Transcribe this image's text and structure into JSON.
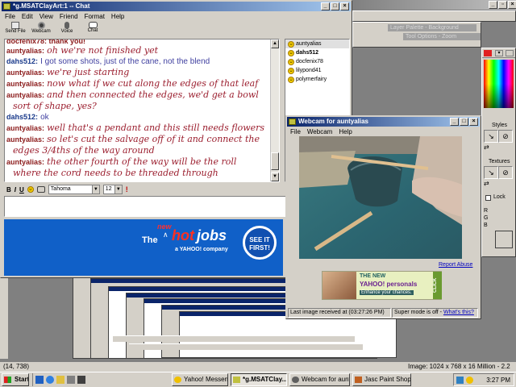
{
  "chat": {
    "title": "*g.MSATClayArt:1 -- Chat",
    "menus": [
      "File",
      "Edit",
      "View",
      "Friend",
      "Format",
      "Help"
    ],
    "toolbar": [
      "Send File",
      "Webcam",
      "Voice",
      "Chat"
    ],
    "partial_top": "docfenix78: thank you!",
    "lines": [
      {
        "who": "auntyalias:",
        "text": "oh we're not finished yet",
        "kind": "a"
      },
      {
        "who": "dahs512:",
        "text": "I got some shots, just of the cane, not the blend",
        "kind": "d"
      },
      {
        "who": "auntyalias:",
        "text": "we're just starting",
        "kind": "a"
      },
      {
        "who": "auntyalias:",
        "text": "now what if we cut along the edges of that leaf",
        "kind": "a"
      },
      {
        "who": "auntyalias:",
        "text": "and then connected the edges, we'd get a bowl",
        "kind": "a"
      },
      {
        "who": "",
        "text": "sort of shape, yes?",
        "kind": "c"
      },
      {
        "who": "dahs512:",
        "text": "ok",
        "kind": "d"
      },
      {
        "who": "auntyalias:",
        "text": "well that's a pendant and this still needs flowers",
        "kind": "a"
      },
      {
        "who": "auntyalias:",
        "text": "so let's cut the salvage off of it and connect the",
        "kind": "a"
      },
      {
        "who": "",
        "text": "edges 3/4ths of the way around",
        "kind": "c"
      },
      {
        "who": "auntyalias:",
        "text": "the other fourth of the way will be the roll",
        "kind": "a"
      },
      {
        "who": "",
        "text": "where the cord needs to be threaded through",
        "kind": "c"
      }
    ],
    "friends": [
      "auntyalias",
      "dahs512",
      "docfenix78",
      "lilypond41",
      "polymerfairy"
    ],
    "format": {
      "bold": "B",
      "italic": "I",
      "underline": "U",
      "font": "Tahoma",
      "size": "12"
    },
    "ad": {
      "the": "The",
      "new": "new",
      "hot": "hot",
      "jobs": "jobs",
      "sub": "a YAHOO! company",
      "badge1": "SEE IT",
      "badge2": "FIRST!"
    }
  },
  "webcam": {
    "title": "Webcam for auntyalias",
    "menus": [
      "File",
      "Webcam",
      "Help"
    ],
    "report": "Report Abuse",
    "ad": {
      "l1": "THE NEW",
      "l2": "YAHOO! personals",
      "l3": "Enhance your chances.",
      "click": "CLICK"
    },
    "last_image": "Last image received at (03:27:26 PM)",
    "super_mode": "Super mode is off - ",
    "whats_this": "What's this?"
  },
  "psp": {
    "layer_palette": "Layer Palette - Background",
    "tool_options": "Tool Options - Zoom",
    "styles": "Styles",
    "textures": "Textures",
    "lock": "Lock",
    "r": "R",
    "g": "G",
    "b": "B"
  },
  "status": {
    "coords": "(14, 738)",
    "image": "Image:  1024 x 768 x 16 Million - 2.2 MBytes"
  },
  "taskbar": {
    "start": "Start",
    "tasks": [
      "Yahoo! Messenger",
      "*g.MSATClay...",
      "Webcam for aunt...",
      "Jasc Paint Shop ..."
    ],
    "clock": "3:27 PM"
  }
}
